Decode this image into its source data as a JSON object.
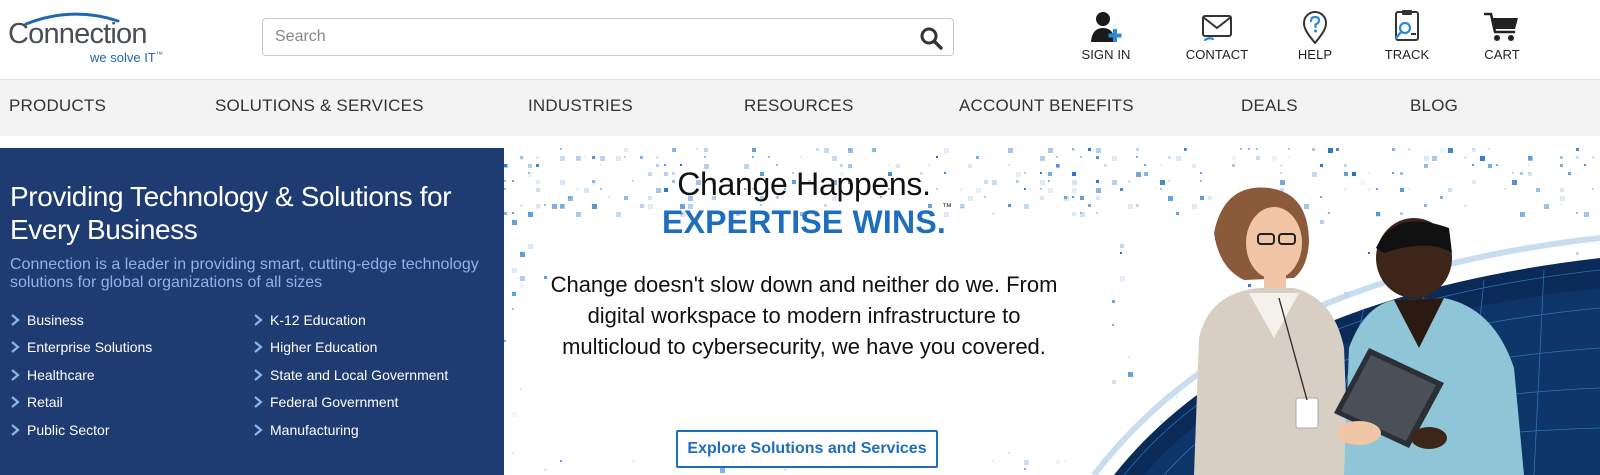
{
  "brand": {
    "name": "Connection",
    "tagline": "we solve IT",
    "tagline_mark": "™",
    "primary_color": "#1f6ebd",
    "dark_blue": "#1e3b72"
  },
  "search": {
    "placeholder": "Search",
    "value": "",
    "icon": "search-icon"
  },
  "utility_nav": [
    {
      "label": "SIGN IN",
      "icon": "user-add-icon"
    },
    {
      "label": "CONTACT",
      "icon": "envelope-icon"
    },
    {
      "label": "HELP",
      "icon": "help-pin-icon"
    },
    {
      "label": "TRACK",
      "icon": "track-icon"
    },
    {
      "label": "CART",
      "icon": "cart-icon"
    }
  ],
  "main_nav": [
    {
      "label": "PRODUCTS"
    },
    {
      "label": "SOLUTIONS & SERVICES"
    },
    {
      "label": "INDUSTRIES"
    },
    {
      "label": "RESOURCES"
    },
    {
      "label": "ACCOUNT BENEFITS"
    },
    {
      "label": "DEALS"
    },
    {
      "label": "BLOG"
    }
  ],
  "panel": {
    "title": "Providing Technology & Solutions for Every Business",
    "description": "Connection is a leader in providing smart, cutting-edge technology solutions for global organizations of all sizes",
    "links_left": [
      "Business",
      "Enterprise Solutions",
      "Healthcare",
      "Retail",
      "Public Sector"
    ],
    "links_right": [
      "K-12 Education",
      "Higher Education",
      "State and Local Government",
      "Federal Government",
      "Manufacturing"
    ]
  },
  "hero": {
    "headline": "Change Happens.",
    "subheadline": "EXPERTISE WINS.",
    "trademark": "™",
    "body": "Change doesn't slow down and neither do we. From digital workspace to modern infrastructure to multicloud to cybersecurity, we have you covered.",
    "cta_label": "Explore Solutions and Services"
  }
}
